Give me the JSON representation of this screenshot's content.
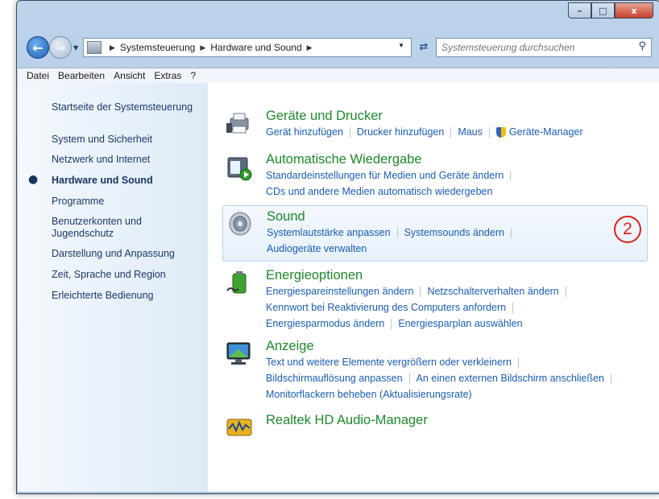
{
  "window": {
    "caption_buttons": [
      "–",
      "□",
      "x"
    ]
  },
  "navigation": {
    "breadcrumb": [
      "Systemsteuerung",
      "Hardware und Sound"
    ],
    "search_placeholder": "Systemsteuerung durchsuchen"
  },
  "menu": [
    "Datei",
    "Bearbeiten",
    "Ansicht",
    "Extras",
    "?"
  ],
  "sidebar": {
    "home": "Startseite der Systemsteuerung",
    "items": [
      {
        "label": "System und Sicherheit",
        "active": false
      },
      {
        "label": "Netzwerk und Internet",
        "active": false
      },
      {
        "label": "Hardware und Sound",
        "active": true
      },
      {
        "label": "Programme",
        "active": false
      },
      {
        "label": "Benutzerkonten und\nJugendschutz",
        "active": false
      },
      {
        "label": "Darstellung und Anpassung",
        "active": false
      },
      {
        "label": "Zeit, Sprache und Region",
        "active": false
      },
      {
        "label": "Erleichterte Bedienung",
        "active": false
      }
    ]
  },
  "groups": [
    {
      "title": "Geräte und Drucker",
      "icon": "printer-icon",
      "rows": [
        [
          "Gerät hinzufügen",
          "Drucker hinzufügen",
          "Maus",
          "Geräte-Manager"
        ]
      ]
    },
    {
      "title": "Automatische Wiedergabe",
      "icon": "autoplay-icon",
      "rows": [
        [
          "Standardeinstellungen für Medien und Geräte ändern"
        ],
        [
          "CDs und andere Medien automatisch wiedergeben"
        ]
      ]
    },
    {
      "title": "Sound",
      "icon": "speaker-icon",
      "highlighted": true,
      "rows": [
        [
          "Systemlautstärke anpassen",
          "Systemsounds ändern"
        ],
        [
          "Audiogeräte verwalten"
        ]
      ]
    },
    {
      "title": "Energieoptionen",
      "icon": "battery-icon",
      "rows": [
        [
          "Energiespareinstellungen ändern",
          "Netzschalterverhalten ändern"
        ],
        [
          "Kennwort bei Reaktivierung des Computers anfordern"
        ],
        [
          "Energiesparmodus ändern",
          "Energiesparplan auswählen"
        ]
      ]
    },
    {
      "title": "Anzeige",
      "icon": "monitor-icon",
      "rows": [
        [
          "Text und weitere Elemente vergrößern oder verkleinern"
        ],
        [
          "Bildschirmauflösung anpassen",
          "An einen externen Bildschirm anschließen"
        ],
        [
          "Monitorflackern beheben (Aktualisierungsrate)"
        ]
      ]
    },
    {
      "title": "Realtek HD Audio-Manager",
      "icon": "realtek-audio-icon",
      "rows": []
    }
  ],
  "annotation": {
    "label": "2",
    "color": "#e0201a"
  },
  "colors": {
    "group_title": "#1b8a2b",
    "link": "#1a5cb8",
    "sidebar_link": "#1b3a6b"
  }
}
